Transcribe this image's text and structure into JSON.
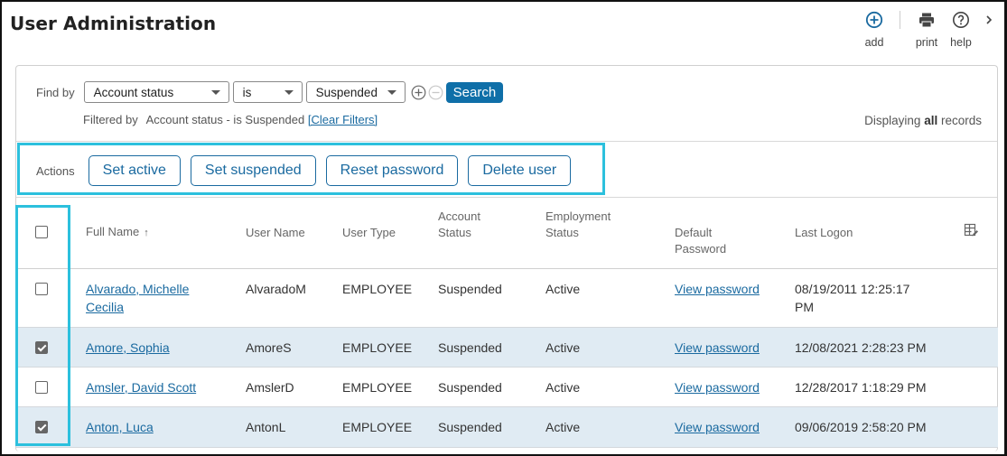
{
  "header": {
    "title": "User Administration",
    "toolbar": [
      {
        "id": "add",
        "label": "add",
        "icon": "plus-circle-icon"
      },
      {
        "id": "print",
        "label": "print",
        "icon": "printer-icon"
      },
      {
        "id": "help",
        "label": "help",
        "icon": "help-circle-icon"
      },
      {
        "id": "more",
        "label": "",
        "icon": "chevron-right-icon"
      }
    ]
  },
  "filter": {
    "find_by_label": "Find by",
    "field": "Account status",
    "operator": "is",
    "value": "Suspended",
    "search_label": "Search",
    "filtered_by_label": "Filtered by",
    "filtered_by_text": "Account status - is Suspended",
    "clear_filters_label": "[Clear Filters]",
    "display_prefix": "Displaying",
    "display_bold": "all",
    "display_suffix": "records"
  },
  "actions": {
    "label": "Actions",
    "buttons": [
      "Set active",
      "Set suspended",
      "Reset password",
      "Delete user"
    ]
  },
  "table": {
    "columns": {
      "full_name": "Full Name",
      "sort_indicator": "↑",
      "user_name": "User Name",
      "user_type": "User Type",
      "account_status_1": "Account",
      "account_status_2": "Status",
      "employment_status_1": "Employment",
      "employment_status_2": "Status",
      "default_password_1": "Default",
      "default_password_2": "Password",
      "last_logon": "Last Logon"
    },
    "rows": [
      {
        "checked": false,
        "full_name_1": "Alvarado, Michelle",
        "full_name_2": "Cecilia",
        "user_name": "AlvaradoM",
        "user_type": "EMPLOYEE",
        "account_status": "Suspended",
        "employment_status": "Active",
        "default_password": "View password",
        "last_logon_1": "08/19/2011 12:25:17",
        "last_logon_2": "PM"
      },
      {
        "checked": true,
        "full_name_1": "Amore, Sophia",
        "full_name_2": "",
        "user_name": "AmoreS",
        "user_type": "EMPLOYEE",
        "account_status": "Suspended",
        "employment_status": "Active",
        "default_password": "View password",
        "last_logon_1": "12/08/2021 2:28:23 PM",
        "last_logon_2": ""
      },
      {
        "checked": false,
        "full_name_1": "Amsler, David Scott",
        "full_name_2": "",
        "user_name": "AmslerD",
        "user_type": "EMPLOYEE",
        "account_status": "Suspended",
        "employment_status": "Active",
        "default_password": "View password",
        "last_logon_1": "12/28/2017 1:18:29 PM",
        "last_logon_2": ""
      },
      {
        "checked": true,
        "full_name_1": "Anton, Luca",
        "full_name_2": "",
        "user_name": "AntonL",
        "user_type": "EMPLOYEE",
        "account_status": "Suspended",
        "employment_status": "Active",
        "default_password": "View password",
        "last_logon_1": "09/06/2019 2:58:20 PM",
        "last_logon_2": ""
      }
    ]
  },
  "colors": {
    "accent": "#1a6aa0",
    "search_button": "#0f6fa8",
    "highlight_outline": "#2cc0dd",
    "selected_row": "#e0ebf3"
  }
}
